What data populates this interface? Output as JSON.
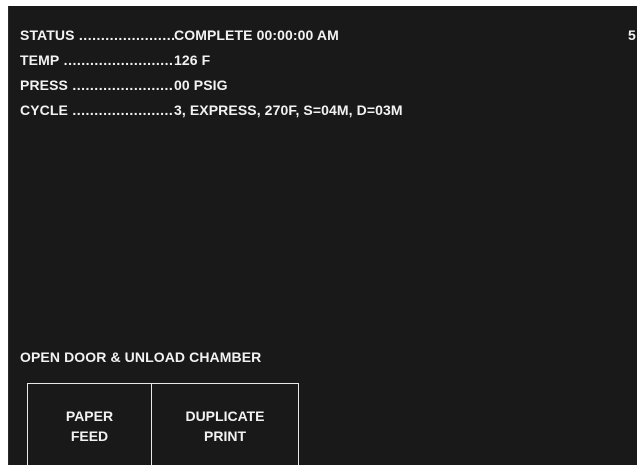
{
  "screen": {
    "page_number": "5",
    "lines": [
      {
        "label": "STATUS",
        "value": "COMPLETE 00:00:00 AM"
      },
      {
        "label": "TEMP",
        "value": "126 F"
      },
      {
        "label": "PRESS",
        "value": "00 PSIG"
      },
      {
        "label": "CYCLE",
        "value": "3, EXPRESS, 270F, S=04M, D=03M"
      }
    ],
    "message": "OPEN DOOR & UNLOAD CHAMBER"
  },
  "buttons": {
    "paper_feed": {
      "line1": "PAPER",
      "line2": "FEED"
    },
    "duplicate_print": {
      "line1": "DUPLICATE",
      "line2": "PRINT"
    }
  },
  "colors": {
    "background": "#191919",
    "text": "#f2f2f2",
    "button_border": "#e8e8e8"
  }
}
